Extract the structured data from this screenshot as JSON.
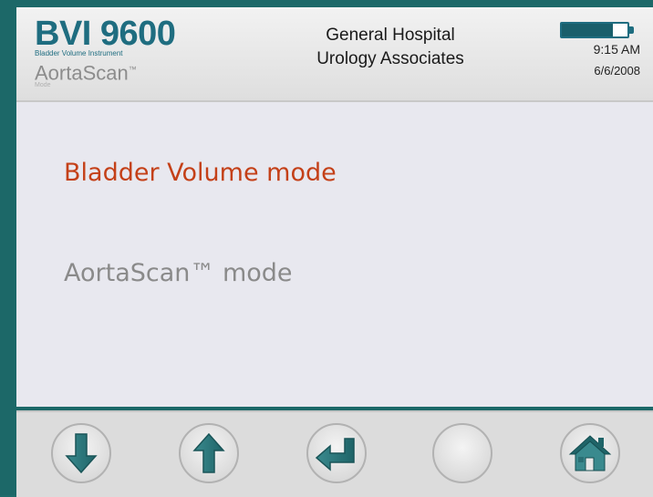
{
  "header": {
    "model": "BVI 9600",
    "subtitle": "Bladder Volume Instrument",
    "mode_name": "AortaScan",
    "mode_tm": "™",
    "mode_caption": "Mode",
    "facility_line1": "General Hospital",
    "facility_line2": "Urology Associates",
    "time": "9:15 AM",
    "date": "6/6/2008",
    "battery_level": 0.78
  },
  "menu": {
    "items": [
      {
        "label": "Bladder Volume mode",
        "selected": true
      },
      {
        "label": "AortaScan™ mode",
        "selected": false
      }
    ]
  },
  "footer": {
    "buttons": [
      {
        "icon": "arrow-down-icon"
      },
      {
        "icon": "arrow-up-icon"
      },
      {
        "icon": "enter-icon"
      },
      {
        "icon": "blank"
      },
      {
        "icon": "home-icon"
      }
    ]
  },
  "colors": {
    "accent": "#1f6d80",
    "selected": "#c44018",
    "unselected": "#8a8a8a",
    "bezel": "#1c6868"
  }
}
